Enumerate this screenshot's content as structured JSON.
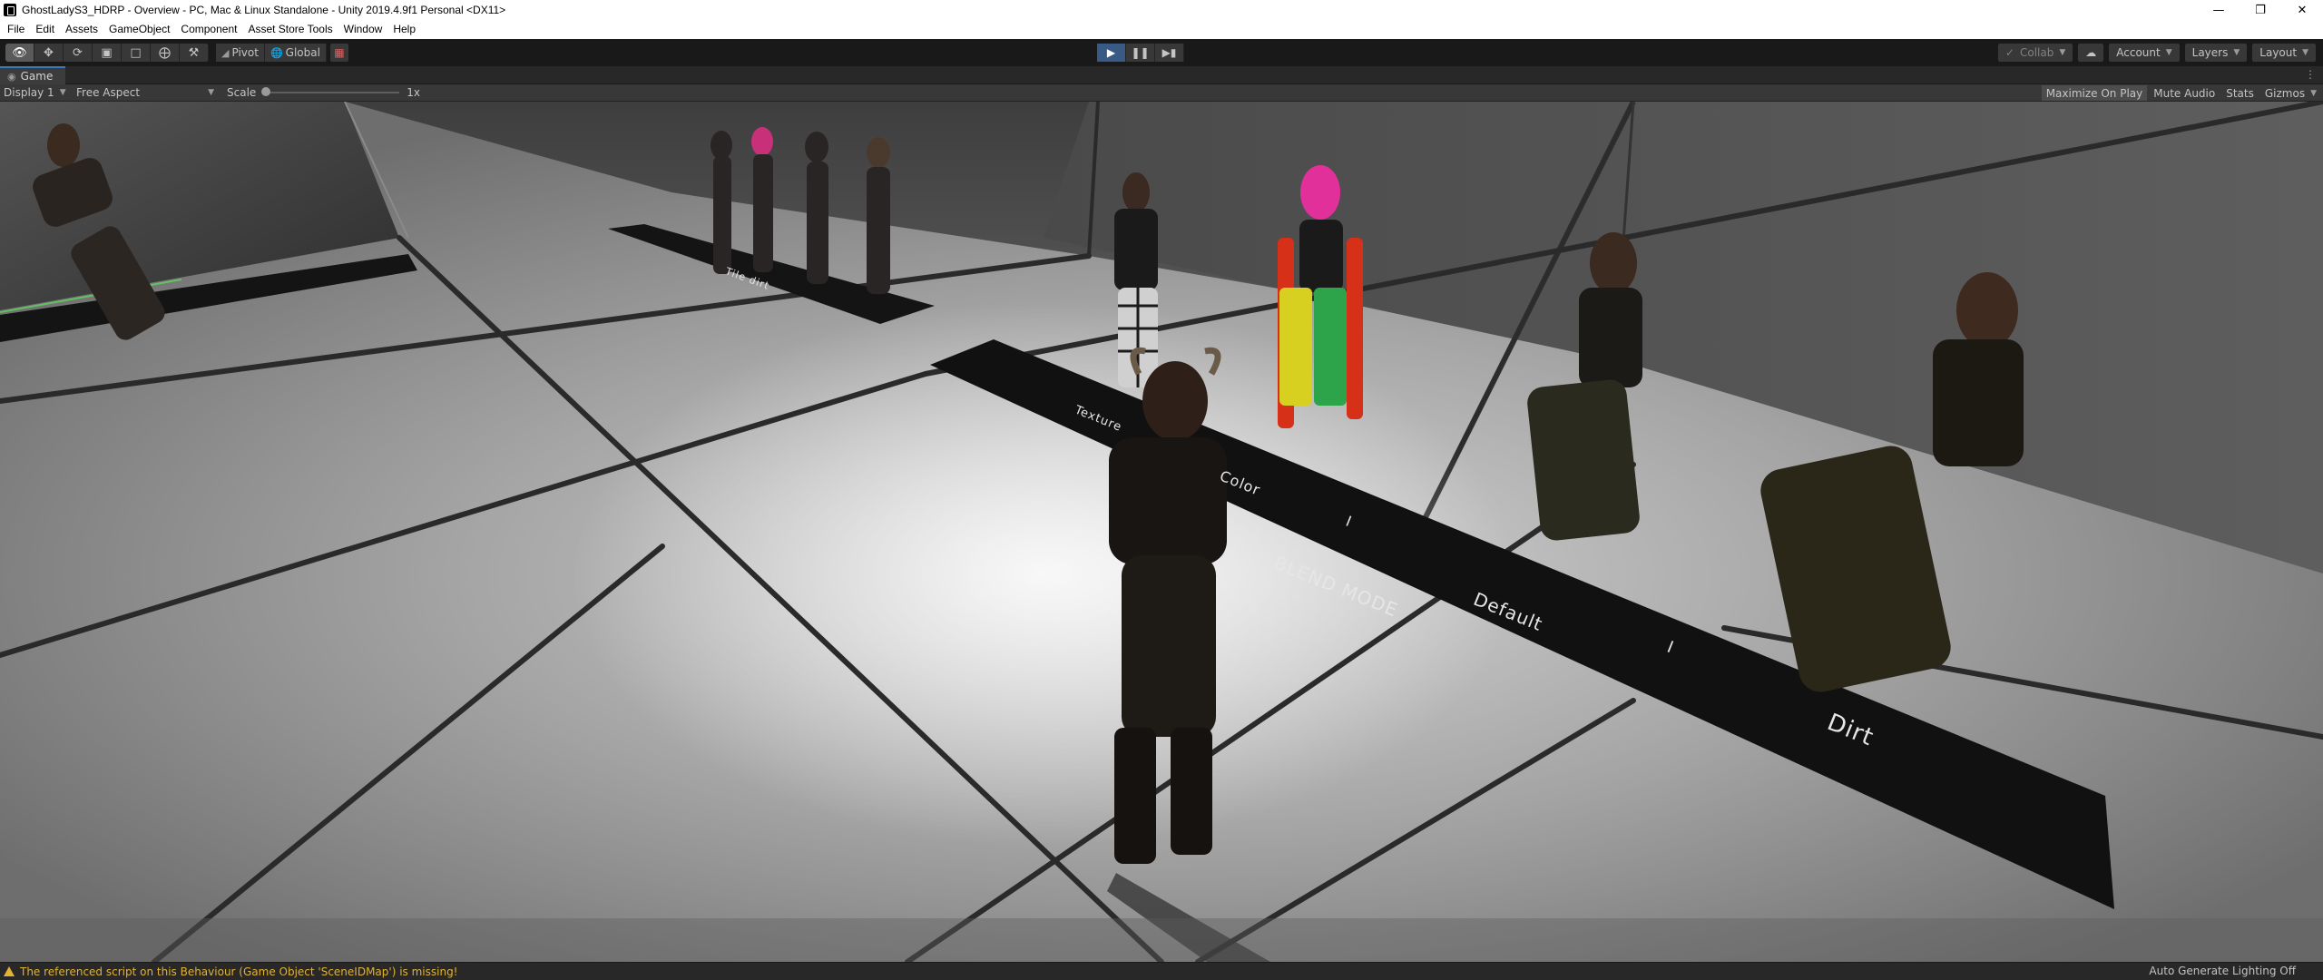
{
  "window": {
    "title": "GhostLadyS3_HDRP - Overview - PC, Mac & Linux Standalone - Unity 2019.4.9f1 Personal <DX11>",
    "minimize_icon": "minimize-icon",
    "maximize_icon": "restore-icon",
    "close_icon": "close-icon"
  },
  "menu": {
    "items": [
      "File",
      "Edit",
      "Assets",
      "GameObject",
      "Component",
      "Asset Store Tools",
      "Window",
      "Help"
    ]
  },
  "toolbar": {
    "tools": [
      "view-hand-icon",
      "move-icon",
      "rotate-icon",
      "scale-icon",
      "rect-tool-icon",
      "transform-tool-icon",
      "custom-tool-icon"
    ],
    "pivot_label": "Pivot",
    "global_label": "Global",
    "play_icon": "play-icon",
    "pause_icon": "pause-icon",
    "step_icon": "step-icon",
    "collab_label": "Collab",
    "account_label": "Account",
    "layers_label": "Layers",
    "layout_label": "Layout"
  },
  "game_tab": {
    "label": "Game",
    "display": "Display 1",
    "aspect": "Free Aspect",
    "scale_label": "Scale",
    "scale_value": "1x",
    "maximize_on_play": "Maximize On Play",
    "mute_audio": "Mute Audio",
    "stats": "Stats",
    "gizmos": "Gizmos"
  },
  "scene": {
    "floor_labels": {
      "small_plate": "Tile dirt",
      "main_1": "Texture",
      "main_2": "Color",
      "main_3": "I",
      "main_4": "BLEND MODE",
      "main_5": "Default",
      "main_6": "I",
      "main_7": "Dirt"
    }
  },
  "status": {
    "warning": "The referenced script on this Behaviour (Game Object 'SceneIDMap') is missing!",
    "lighting": "Auto Generate Lighting Off"
  },
  "colors": {
    "warning": "#e3b233",
    "play_active": "#3a5a86",
    "tab_accent": "#3a79bb"
  }
}
